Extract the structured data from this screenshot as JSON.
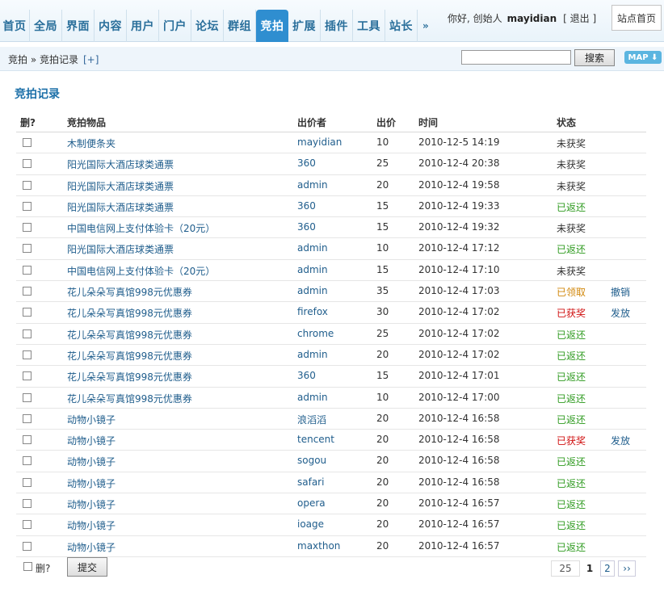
{
  "nav": {
    "tabs": [
      "首页",
      "全局",
      "界面",
      "内容",
      "用户",
      "门户",
      "论坛",
      "群组",
      "竞拍",
      "扩展",
      "插件",
      "工具",
      "站长"
    ],
    "active": "竞拍",
    "more": "»"
  },
  "user": {
    "greeting": "你好, 创始人",
    "name": "mayidian",
    "logout": "[ 退出 ]",
    "site_home": "站点首页"
  },
  "breadcrumb": {
    "text": "竞拍 » 竞拍记录",
    "add": "[+]"
  },
  "search": {
    "value": "",
    "button": "搜索",
    "map": "MAP ⬇"
  },
  "title": "竞拍记录",
  "table": {
    "headers": {
      "del": "删?",
      "item": "竞拍物品",
      "bidder": "出价者",
      "price": "出价",
      "time": "时间",
      "status": "状态"
    },
    "rows": [
      {
        "item": "木制便条夹",
        "bidder": "mayidian",
        "price": "10",
        "time": "2010-12-5 14:19",
        "status": "未获奖",
        "status_kind": "none",
        "action": ""
      },
      {
        "item": "阳光国际大酒店球类通票",
        "bidder": "360",
        "price": "25",
        "time": "2010-12-4 20:38",
        "status": "未获奖",
        "status_kind": "none",
        "action": ""
      },
      {
        "item": "阳光国际大酒店球类通票",
        "bidder": "admin",
        "price": "20",
        "time": "2010-12-4 19:58",
        "status": "未获奖",
        "status_kind": "none",
        "action": ""
      },
      {
        "item": "阳光国际大酒店球类通票",
        "bidder": "360",
        "price": "15",
        "time": "2010-12-4 19:33",
        "status": "已返还",
        "status_kind": "ret",
        "action": ""
      },
      {
        "item": "中国电信网上支付体验卡（20元）",
        "bidder": "360",
        "price": "15",
        "time": "2010-12-4 19:32",
        "status": "未获奖",
        "status_kind": "none",
        "action": ""
      },
      {
        "item": "阳光国际大酒店球类通票",
        "bidder": "admin",
        "price": "10",
        "time": "2010-12-4 17:12",
        "status": "已返还",
        "status_kind": "ret",
        "action": ""
      },
      {
        "item": "中国电信网上支付体验卡（20元）",
        "bidder": "admin",
        "price": "15",
        "time": "2010-12-4 17:10",
        "status": "未获奖",
        "status_kind": "none",
        "action": ""
      },
      {
        "item": "花儿朵朵写真馆998元优惠券",
        "bidder": "admin",
        "price": "35",
        "time": "2010-12-4 17:03",
        "status": "已领取",
        "status_kind": "got",
        "action": "撤销"
      },
      {
        "item": "花儿朵朵写真馆998元优惠券",
        "bidder": "firefox",
        "price": "30",
        "time": "2010-12-4 17:02",
        "status": "已获奖",
        "status_kind": "won",
        "action": "发放"
      },
      {
        "item": "花儿朵朵写真馆998元优惠券",
        "bidder": "chrome",
        "price": "25",
        "time": "2010-12-4 17:02",
        "status": "已返还",
        "status_kind": "ret",
        "action": ""
      },
      {
        "item": "花儿朵朵写真馆998元优惠券",
        "bidder": "admin",
        "price": "20",
        "time": "2010-12-4 17:02",
        "status": "已返还",
        "status_kind": "ret",
        "action": ""
      },
      {
        "item": "花儿朵朵写真馆998元优惠券",
        "bidder": "360",
        "price": "15",
        "time": "2010-12-4 17:01",
        "status": "已返还",
        "status_kind": "ret",
        "action": ""
      },
      {
        "item": "花儿朵朵写真馆998元优惠券",
        "bidder": "admin",
        "price": "10",
        "time": "2010-12-4 17:00",
        "status": "已返还",
        "status_kind": "ret",
        "action": ""
      },
      {
        "item": "动物小镜子",
        "bidder": "浪滔滔",
        "price": "20",
        "time": "2010-12-4 16:58",
        "status": "已返还",
        "status_kind": "ret",
        "action": ""
      },
      {
        "item": "动物小镜子",
        "bidder": "tencent",
        "price": "20",
        "time": "2010-12-4 16:58",
        "status": "已获奖",
        "status_kind": "won",
        "action": "发放"
      },
      {
        "item": "动物小镜子",
        "bidder": "sogou",
        "price": "20",
        "time": "2010-12-4 16:58",
        "status": "已返还",
        "status_kind": "ret",
        "action": ""
      },
      {
        "item": "动物小镜子",
        "bidder": "safari",
        "price": "20",
        "time": "2010-12-4 16:58",
        "status": "已返还",
        "status_kind": "ret",
        "action": ""
      },
      {
        "item": "动物小镜子",
        "bidder": "opera",
        "price": "20",
        "time": "2010-12-4 16:57",
        "status": "已返还",
        "status_kind": "ret",
        "action": ""
      },
      {
        "item": "动物小镜子",
        "bidder": "ioage",
        "price": "20",
        "time": "2010-12-4 16:57",
        "status": "已返还",
        "status_kind": "ret",
        "action": ""
      },
      {
        "item": "动物小镜子",
        "bidder": "maxthon",
        "price": "20",
        "time": "2010-12-4 16:57",
        "status": "已返还",
        "status_kind": "ret",
        "action": ""
      }
    ]
  },
  "footer": {
    "del_label": "删?",
    "submit": "提交",
    "pager": {
      "total": "25",
      "current": "1",
      "next_page": "2",
      "next": "››"
    }
  }
}
